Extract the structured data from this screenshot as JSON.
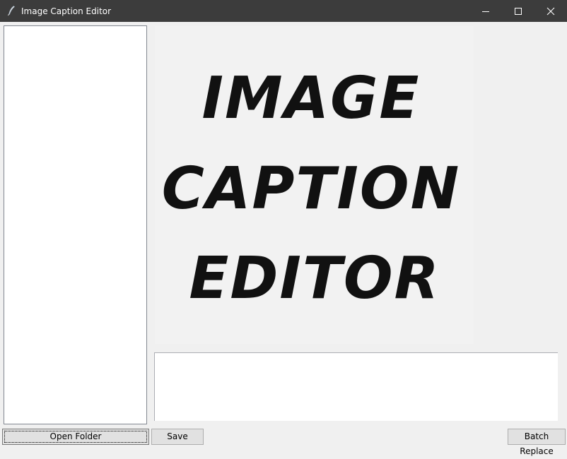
{
  "window": {
    "title": "Image Caption Editor",
    "icon": "feather-icon",
    "controls": [
      "minimize-icon",
      "maximize-icon",
      "close-icon"
    ]
  },
  "file_list": {
    "items": []
  },
  "preview": {
    "image_text_lines": [
      "IMAGE",
      "CAPTION",
      "EDITOR"
    ]
  },
  "caption_editor": {
    "value": ""
  },
  "buttons": {
    "open_folder": "Open Folder",
    "save": "Save",
    "batch_replace": "Batch Replace"
  },
  "colors": {
    "titlebar": "#3c3c3c",
    "window_bg": "#f0f0f0",
    "button_bg": "#e1e1e1",
    "preview_bg": "#f2f2f2"
  }
}
